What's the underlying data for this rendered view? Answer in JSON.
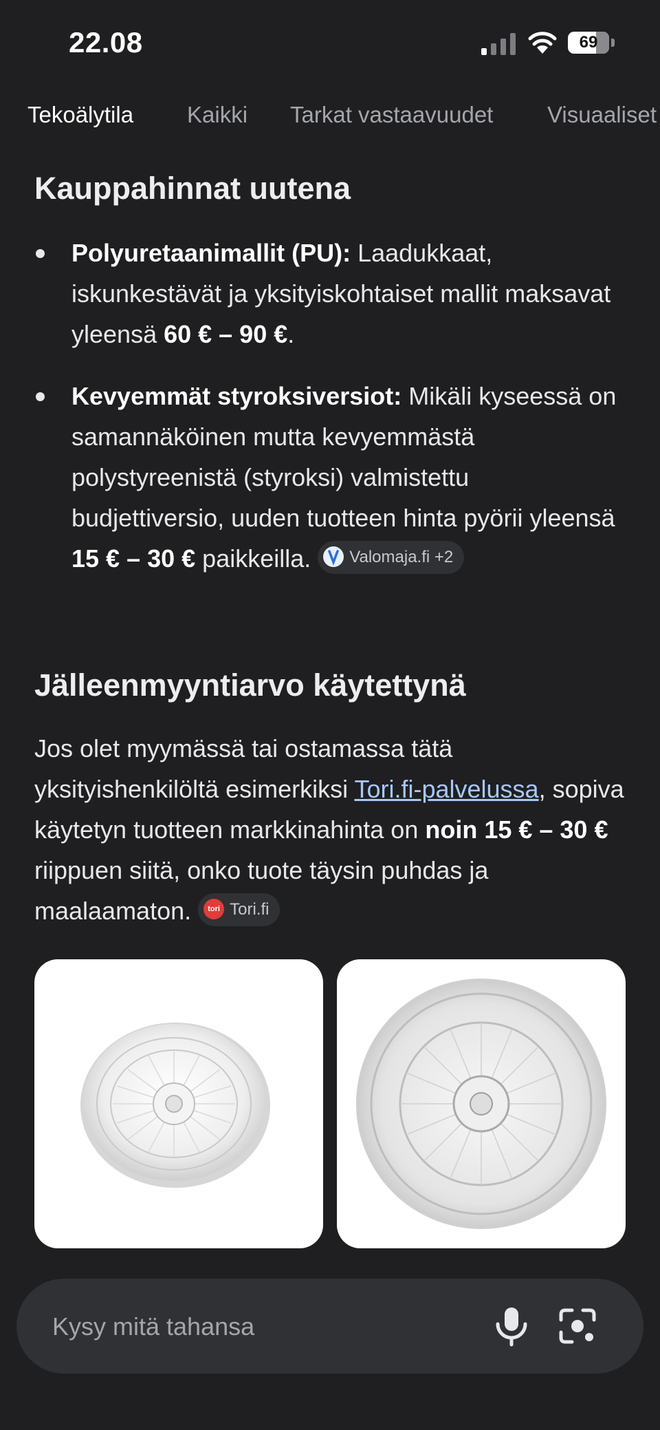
{
  "status_bar": {
    "time": "22.08",
    "battery": "69"
  },
  "tabs": [
    {
      "label": "Tekoälytila",
      "active": true
    },
    {
      "label": "Kaikki"
    },
    {
      "label": "Tarkat vastaavuudet"
    },
    {
      "label": "Visuaaliset"
    }
  ],
  "section1": {
    "title": "Kauppahinnat uutena",
    "bullet1": {
      "strong": "Polyuretaanimallit (PU):",
      "text": " Laadukkaat, iskunkestävät ja yksityiskohtaiset mallit maksavat yleensä ",
      "price": "60 € – 90 €",
      "end": "."
    },
    "bullet2": {
      "strong": "Kevyemmät styroksiversiot:",
      "text": " Mikäli kyseessä on samannäköinen mutta kevyemmästä polystyreenistä (styroksi) valmistettu budjettiversio, uuden tuotteen hinta pyörii yleensä ",
      "price": "15 € – 30 €",
      "end": " paikkeilla.",
      "source": "Valomaja.fi +2"
    }
  },
  "section2": {
    "title": "Jälleenmyyntiarvo käytettynä",
    "text1": "Jos olet myymässä tai ostamassa tätä yksityishenkilöltä esimerkiksi ",
    "link": "Tori.fi-palvelussa",
    "text2": ", sopiva käytetyn tuotteen markkinahinta on ",
    "strong": "noin 15 € – 30 €",
    "text3": " riippuen siitä, onko tuote täysin puhdas ja maalaamaton.",
    "source": "Tori.fi",
    "source_icon_text": "tori"
  },
  "search": {
    "placeholder": "Kysy mitä tahansa"
  },
  "icons": {
    "signal": "signal-icon",
    "wifi": "wifi-icon",
    "battery": "battery-icon",
    "mic": "mic-icon",
    "lens": "lens-icon"
  },
  "colors": {
    "background": "#1f1f21",
    "link": "#a8c7fa",
    "surface": "#303134"
  }
}
